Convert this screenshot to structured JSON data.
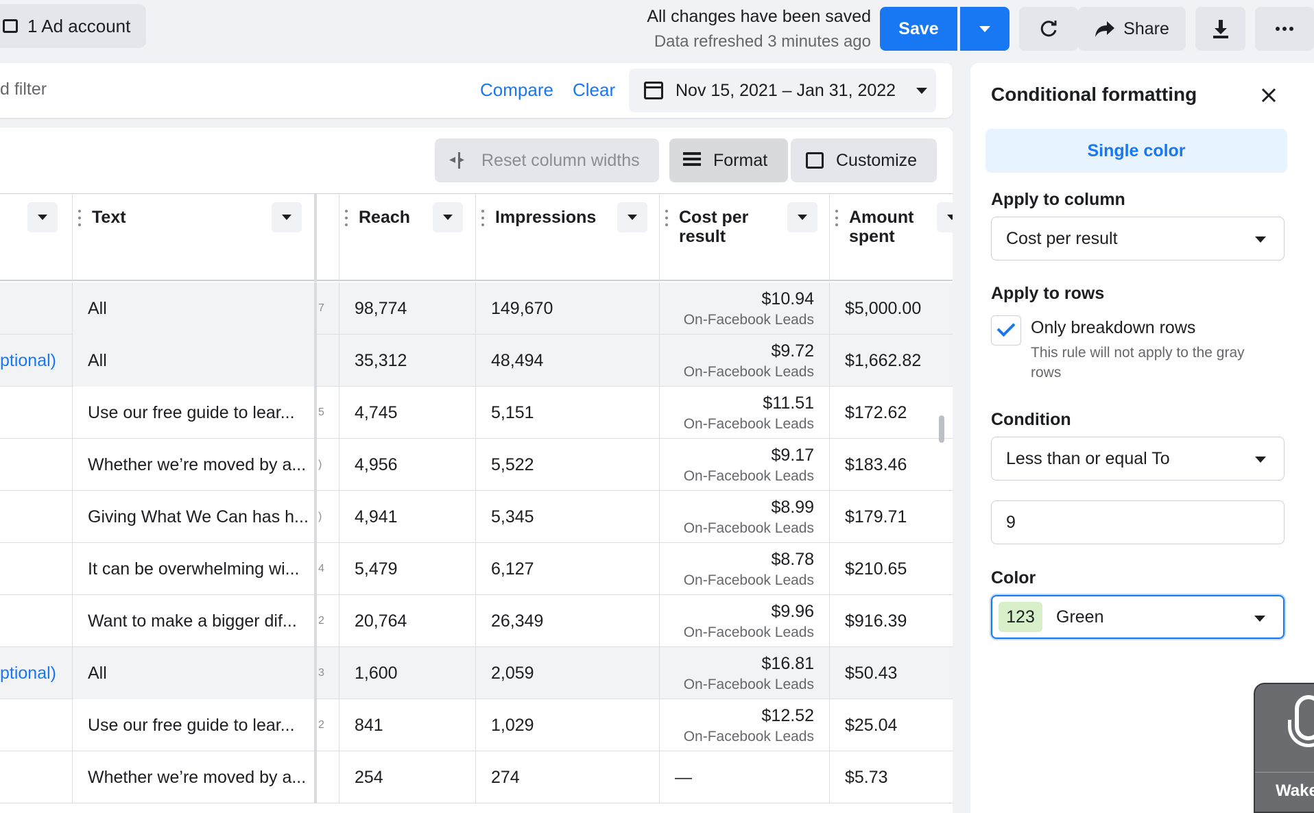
{
  "topbar": {
    "ad_account_label": "1 Ad account",
    "save_status": "All changes have been saved",
    "refresh_status": "Data refreshed 3 minutes ago",
    "save_label": "Save",
    "share_label": "Share"
  },
  "filterbar": {
    "filter_placeholder": "d filter",
    "compare_label": "Compare",
    "clear_label": "Clear",
    "date_range": "Nov 15, 2021 – Jan 31, 2022"
  },
  "toolbar": {
    "reset_label": "Reset column widths",
    "format_label": "Format",
    "customize_label": "Customize"
  },
  "table": {
    "columns": {
      "text": "Text",
      "reach": "Reach",
      "impressions": "Impressions",
      "cost_per_result": "Cost per result",
      "amount_spent": "Amount spent"
    },
    "rows": [
      {
        "name": "",
        "text": "All",
        "narrow": "7",
        "reach": "98,774",
        "impressions": "149,670",
        "cpr": "$10.94",
        "cpr_sub": "On-Facebook Leads",
        "amount": "$5,000.00",
        "gray": true
      },
      {
        "name": "ptional)",
        "text": "All",
        "narrow": "",
        "reach": "35,312",
        "impressions": "48,494",
        "cpr": "$9.72",
        "cpr_sub": "On-Facebook Leads",
        "amount": "$1,662.82",
        "gray": true
      },
      {
        "name": "",
        "text": "Use our free guide to lear...",
        "narrow": "5",
        "reach": "4,745",
        "impressions": "5,151",
        "cpr": "$11.51",
        "cpr_sub": "On-Facebook Leads",
        "amount": "$172.62",
        "gray": false
      },
      {
        "name": "",
        "text": "Whether we’re moved by a...",
        "narrow": ")",
        "reach": "4,956",
        "impressions": "5,522",
        "cpr": "$9.17",
        "cpr_sub": "On-Facebook Leads",
        "amount": "$183.46",
        "gray": false
      },
      {
        "name": "",
        "text": "Giving What We Can has h...",
        "narrow": ")",
        "reach": "4,941",
        "impressions": "5,345",
        "cpr": "$8.99",
        "cpr_sub": "On-Facebook Leads",
        "amount": "$179.71",
        "gray": false
      },
      {
        "name": "",
        "text": "It can be overwhelming wi...",
        "narrow": "4",
        "reach": "5,479",
        "impressions": "6,127",
        "cpr": "$8.78",
        "cpr_sub": "On-Facebook Leads",
        "amount": "$210.65",
        "gray": false
      },
      {
        "name": "",
        "text": "Want to make a bigger dif...",
        "narrow": "2",
        "reach": "20,764",
        "impressions": "26,349",
        "cpr": "$9.96",
        "cpr_sub": "On-Facebook Leads",
        "amount": "$916.39",
        "gray": false
      },
      {
        "name": "ptional)",
        "text": "All",
        "narrow": "3",
        "reach": "1,600",
        "impressions": "2,059",
        "cpr": "$16.81",
        "cpr_sub": "On-Facebook Leads",
        "amount": "$50.43",
        "gray": true
      },
      {
        "name": "",
        "text": "Use our free guide to lear...",
        "narrow": "2",
        "reach": "841",
        "impressions": "1,029",
        "cpr": "$12.52",
        "cpr_sub": "On-Facebook Leads",
        "amount": "$25.04",
        "gray": false
      },
      {
        "name": "",
        "text": "Whether we’re moved by a...",
        "narrow": "",
        "reach": "254",
        "impressions": "274",
        "cpr": "—",
        "cpr_sub": "",
        "amount": "$5.73",
        "gray": false
      }
    ]
  },
  "panel": {
    "title": "Conditional formatting",
    "tab_label": "Single color",
    "apply_column_label": "Apply to column",
    "apply_column_value": "Cost per result",
    "apply_rows_label": "Apply to rows",
    "only_breakdown_label": "Only breakdown rows",
    "only_breakdown_help": "This rule will not apply to the gray rows",
    "condition_label": "Condition",
    "condition_value": "Less than or equal To",
    "threshold_value": "9",
    "color_label": "Color",
    "color_swatch_text": "123",
    "color_value": "Green"
  },
  "dictation": {
    "label": "Wake"
  },
  "colors": {
    "accent": "#1877f2",
    "swatch_green": "#d7f0c9"
  }
}
